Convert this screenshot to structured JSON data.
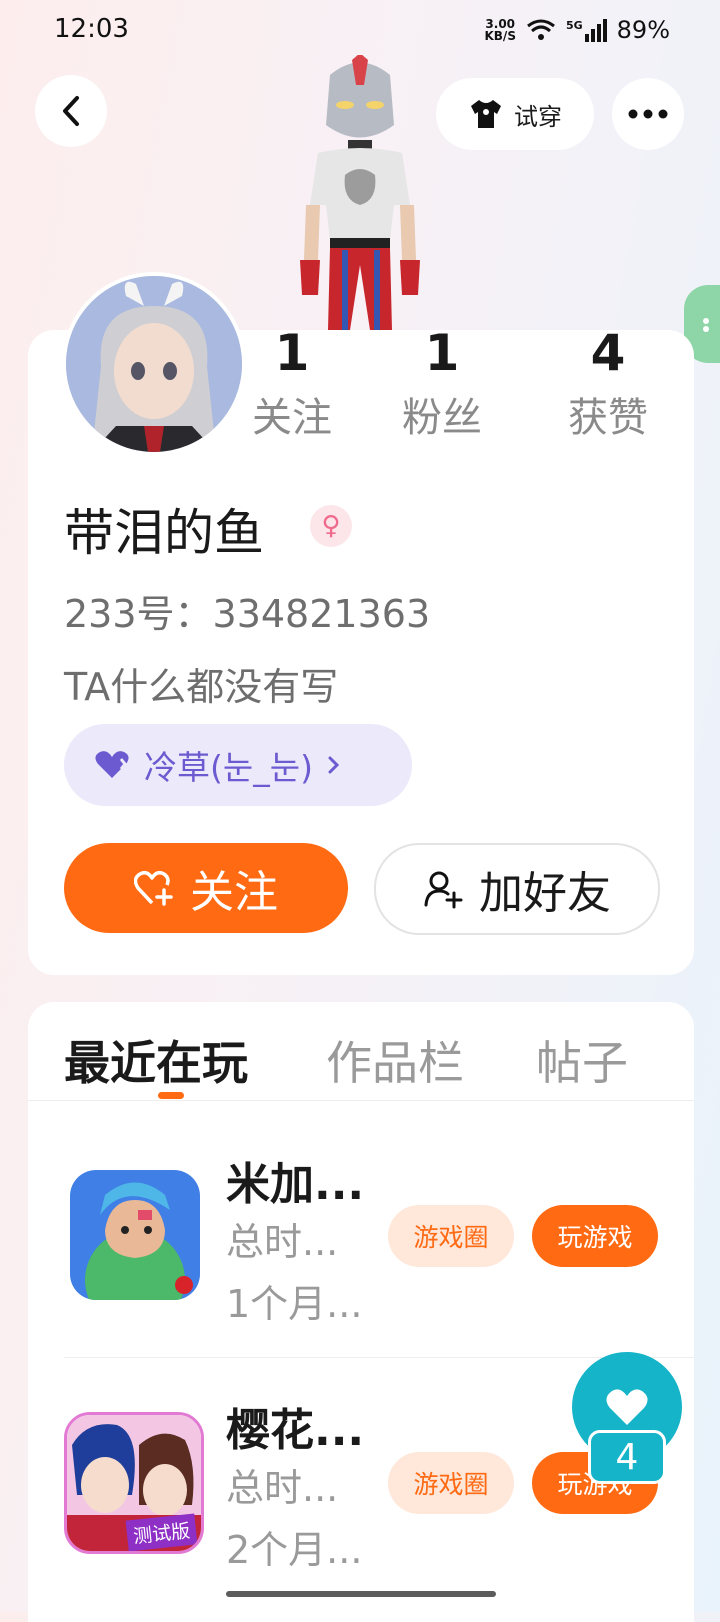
{
  "status_bar": {
    "time": "12:03",
    "net_speed_value": "3.00",
    "net_speed_unit": "KB/S",
    "signal_label": "5G",
    "battery": "89%"
  },
  "header": {
    "try_on_label": "试穿"
  },
  "profile": {
    "stats": [
      {
        "count": "1",
        "label": "关注"
      },
      {
        "count": "1",
        "label": "粉丝"
      },
      {
        "count": "4",
        "label": "获赞"
      }
    ],
    "nickname": "带泪的鱼",
    "gender_symbol": "♀",
    "id_line": "233号：334821363",
    "bio": "TA什么都没有写",
    "guild_label": "冷草(눈_눈)",
    "follow_label": "关注",
    "add_friend_label": "加好友"
  },
  "tabs": [
    "最近在玩",
    "作品栏",
    "帖子"
  ],
  "games": [
    {
      "title": "米加...",
      "duration": "总时...",
      "last_played": "1个月...",
      "circle_label": "游戏圈",
      "play_label": "玩游戏"
    },
    {
      "title": "樱花...",
      "duration": "总时...",
      "last_played": "2个月...",
      "circle_label": "游戏圈",
      "play_label": "玩游戏",
      "icon_badge": "测试版"
    }
  ],
  "fab": {
    "count": "4"
  },
  "colors": {
    "accent": "#ff6a13",
    "fab": "#16b4c8",
    "guild": "#6c5bd0"
  }
}
